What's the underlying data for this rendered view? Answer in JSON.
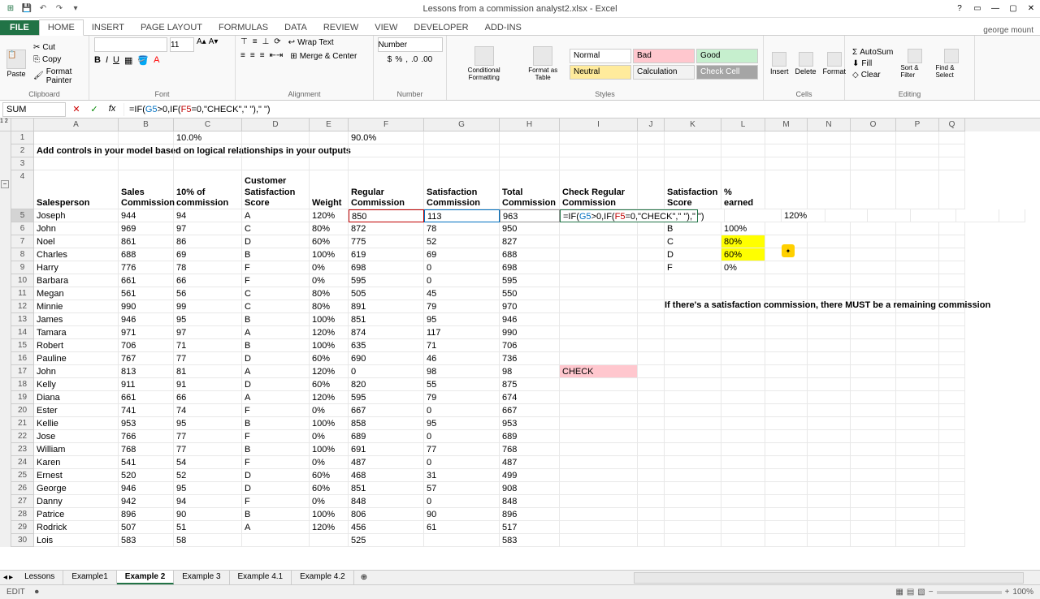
{
  "title": "Lessons from a commission analyst2.xlsx - Excel",
  "user": "george mount",
  "tabs": [
    "FILE",
    "HOME",
    "INSERT",
    "PAGE LAYOUT",
    "FORMULAS",
    "DATA",
    "REVIEW",
    "VIEW",
    "DEVELOPER",
    "ADD-INS"
  ],
  "active_tab": 1,
  "ribbon": {
    "clipboard": {
      "label": "Clipboard",
      "paste": "Paste",
      "cut": "Cut",
      "copy": "Copy",
      "painter": "Format Painter"
    },
    "font": {
      "label": "Font",
      "family": "",
      "size": "11"
    },
    "alignment": {
      "label": "Alignment",
      "wrap": "Wrap Text",
      "merge": "Merge & Center"
    },
    "number": {
      "label": "Number",
      "format": "Number"
    },
    "styles": {
      "label": "Styles",
      "conditional": "Conditional Formatting",
      "table": "Format as Table",
      "cell": "Cell Styles",
      "cells": [
        [
          "Normal",
          "Bad",
          "Good"
        ],
        [
          "Neutral",
          "Calculation",
          "Check Cell"
        ]
      ],
      "cell_bg": [
        [
          "#fff",
          "#ffc7ce",
          "#c6efce"
        ],
        [
          "#ffeb9c",
          "#f2f2f2",
          "#a5a5a5"
        ]
      ]
    },
    "cells_g": {
      "label": "Cells",
      "insert": "Insert",
      "delete": "Delete",
      "format": "Format"
    },
    "editing": {
      "label": "Editing",
      "autosum": "AutoSum",
      "fill": "Fill",
      "clear": "Clear",
      "sort": "Sort & Filter",
      "find": "Find & Select"
    }
  },
  "name_box": "SUM",
  "formula": "=IF(G5>0,IF(F5=0,\"CHECK\",\" \"),\" \")",
  "formula_parts": [
    {
      "t": "=IF(",
      "c": ""
    },
    {
      "t": "G5",
      "c": "ref-b"
    },
    {
      "t": ">0,IF(",
      "c": ""
    },
    {
      "t": "F5",
      "c": "ref-r"
    },
    {
      "t": "=0,\"CHECK\",\" \"),\" \")",
      "c": ""
    }
  ],
  "columns": [
    "A",
    "B",
    "C",
    "D",
    "E",
    "F",
    "G",
    "H",
    "I",
    "J",
    "K",
    "L",
    "M",
    "N",
    "O",
    "P",
    "Q"
  ],
  "row1": {
    "C": "10.0%",
    "F": "90.0%"
  },
  "note_row2": "Add controls in your model based on logical relationships in your outputs",
  "headers": {
    "A": "Salesperson",
    "B": "Sales Commission",
    "C": "10% of commission",
    "D": "Customer Satisfaction Score",
    "E": "Weight",
    "F": "Regular Commission",
    "G": "Satisfaction Commission",
    "H": "Total Commission",
    "I": "Check Regular Commission",
    "K": "Satisfaction Score",
    "L": "% earned"
  },
  "edit_cell_display": "=IF(G5>0,IF(F5=0,\"CHECK\",\" \"),\" \")",
  "side_note": "If there's a satisfaction commission, there MUST be a remaining commission",
  "aux_rows": [
    {
      "K": "B",
      "L": "100%"
    },
    {
      "K": "C",
      "L": "80%",
      "hl": true
    },
    {
      "K": "D",
      "L": "60%",
      "hl": true
    },
    {
      "K": "F",
      "L": "0%"
    }
  ],
  "data_rows": [
    {
      "n": 5,
      "A": "Joseph",
      "B": "944",
      "C": "94",
      "D": "A",
      "E": "120%",
      "F": "850",
      "G": "113",
      "H": "963",
      "I": "",
      "L": "120%"
    },
    {
      "n": 6,
      "A": "John",
      "B": "969",
      "C": "97",
      "D": "C",
      "E": "80%",
      "F": "872",
      "G": "78",
      "H": "950"
    },
    {
      "n": 7,
      "A": "Noel",
      "B": "861",
      "C": "86",
      "D": "D",
      "E": "60%",
      "F": "775",
      "G": "52",
      "H": "827"
    },
    {
      "n": 8,
      "A": "Charles",
      "B": "688",
      "C": "69",
      "D": "B",
      "E": "100%",
      "F": "619",
      "G": "69",
      "H": "688"
    },
    {
      "n": 9,
      "A": "Harry",
      "B": "776",
      "C": "78",
      "D": "F",
      "E": "0%",
      "F": "698",
      "G": "0",
      "H": "698"
    },
    {
      "n": 10,
      "A": "Barbara",
      "B": "661",
      "C": "66",
      "D": "F",
      "E": "0%",
      "F": "595",
      "G": "0",
      "H": "595"
    },
    {
      "n": 11,
      "A": "Megan",
      "B": "561",
      "C": "56",
      "D": "C",
      "E": "80%",
      "F": "505",
      "G": "45",
      "H": "550"
    },
    {
      "n": 12,
      "A": "Minnie",
      "B": "990",
      "C": "99",
      "D": "C",
      "E": "80%",
      "F": "891",
      "G": "79",
      "H": "970"
    },
    {
      "n": 13,
      "A": "James",
      "B": "946",
      "C": "95",
      "D": "B",
      "E": "100%",
      "F": "851",
      "G": "95",
      "H": "946"
    },
    {
      "n": 14,
      "A": "Tamara",
      "B": "971",
      "C": "97",
      "D": "A",
      "E": "120%",
      "F": "874",
      "G": "117",
      "H": "990"
    },
    {
      "n": 15,
      "A": "Robert",
      "B": "706",
      "C": "71",
      "D": "B",
      "E": "100%",
      "F": "635",
      "G": "71",
      "H": "706"
    },
    {
      "n": 16,
      "A": "Pauline",
      "B": "767",
      "C": "77",
      "D": "D",
      "E": "60%",
      "F": "690",
      "G": "46",
      "H": "736"
    },
    {
      "n": 17,
      "A": "John",
      "B": "813",
      "C": "81",
      "D": "A",
      "E": "120%",
      "F": "0",
      "G": "98",
      "H": "98",
      "I": "CHECK"
    },
    {
      "n": 18,
      "A": "Kelly",
      "B": "911",
      "C": "91",
      "D": "D",
      "E": "60%",
      "F": "820",
      "G": "55",
      "H": "875"
    },
    {
      "n": 19,
      "A": "Diana",
      "B": "661",
      "C": "66",
      "D": "A",
      "E": "120%",
      "F": "595",
      "G": "79",
      "H": "674"
    },
    {
      "n": 20,
      "A": "Ester",
      "B": "741",
      "C": "74",
      "D": "F",
      "E": "0%",
      "F": "667",
      "G": "0",
      "H": "667"
    },
    {
      "n": 21,
      "A": "Kellie",
      "B": "953",
      "C": "95",
      "D": "B",
      "E": "100%",
      "F": "858",
      "G": "95",
      "H": "953"
    },
    {
      "n": 22,
      "A": "Jose",
      "B": "766",
      "C": "77",
      "D": "F",
      "E": "0%",
      "F": "689",
      "G": "0",
      "H": "689"
    },
    {
      "n": 23,
      "A": "William",
      "B": "768",
      "C": "77",
      "D": "B",
      "E": "100%",
      "F": "691",
      "G": "77",
      "H": "768"
    },
    {
      "n": 24,
      "A": "Karen",
      "B": "541",
      "C": "54",
      "D": "F",
      "E": "0%",
      "F": "487",
      "G": "0",
      "H": "487"
    },
    {
      "n": 25,
      "A": "Ernest",
      "B": "520",
      "C": "52",
      "D": "D",
      "E": "60%",
      "F": "468",
      "G": "31",
      "H": "499"
    },
    {
      "n": 26,
      "A": "George",
      "B": "946",
      "C": "95",
      "D": "D",
      "E": "60%",
      "F": "851",
      "G": "57",
      "H": "908"
    },
    {
      "n": 27,
      "A": "Danny",
      "B": "942",
      "C": "94",
      "D": "F",
      "E": "0%",
      "F": "848",
      "G": "0",
      "H": "848"
    },
    {
      "n": 28,
      "A": "Patrice",
      "B": "896",
      "C": "90",
      "D": "B",
      "E": "100%",
      "F": "806",
      "G": "90",
      "H": "896"
    },
    {
      "n": 29,
      "A": "Rodrick",
      "B": "507",
      "C": "51",
      "D": "A",
      "E": "120%",
      "F": "456",
      "G": "61",
      "H": "517"
    },
    {
      "n": 30,
      "A": "Lois",
      "B": "583",
      "C": "58",
      "D": "",
      "E": "",
      "F": "525",
      "G": "",
      "H": "583"
    }
  ],
  "sheet_tabs": [
    "Lessons",
    "Example1",
    "Example 2",
    "Example 3",
    "Example 4.1",
    "Example 4.2"
  ],
  "active_sheet": 2,
  "status": "EDIT",
  "zoom": "100%"
}
